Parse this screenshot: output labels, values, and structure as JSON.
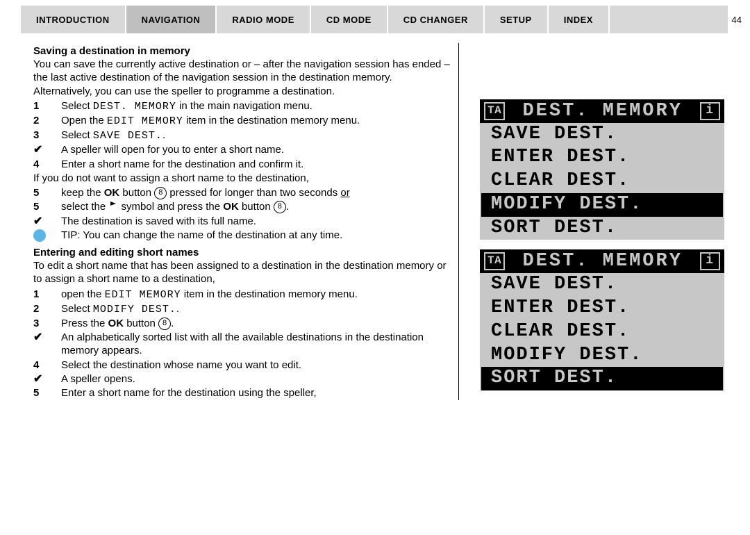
{
  "tabs": [
    "Introduction",
    "Navigation",
    "Radio Mode",
    "Cd Mode",
    "Cd Changer",
    "Setup",
    "Index"
  ],
  "activeTab": 1,
  "pageNumber": "44",
  "section1": {
    "heading": "Saving a destination in memory",
    "intro": "You can save the currently active destination or – after the navigation session has ended – the last active destination of the navigation session in the destination memory. Alternatively, you can use the speller to programme a destination.",
    "s1_pre": "Select ",
    "s1_mono": "DEST. MEMORY",
    "s1_post": " in the main navigation menu.",
    "s2_pre": "Open the ",
    "s2_mono": "EDIT MEMORY",
    "s2_post": " item in the destination memory menu.",
    "s3_pre": "Select ",
    "s3_mono": "SAVE DEST.",
    "s3_post": ".",
    "c1": "A speller will open for you to enter a short name.",
    "s4": "Enter a short name for the destination and confirm it.",
    "para2": "If you do not want to assign a short name to the destination,",
    "s5a_pre": "keep the ",
    "s5a_bold": "OK",
    "s5a_mid": " button ",
    "s5a_btn": "8",
    "s5a_post": " pressed for longer than two seconds ",
    "s5a_or": "or",
    "s5b_pre": "select the ",
    "s5b_mid": " symbol and press the ",
    "s5b_bold": "OK",
    "s5b_mid2": " button ",
    "s5b_btn": "8",
    "s5b_post": ".",
    "c2": "The destination is saved with its full name.",
    "tip": "TIP: You can change the name of the destination at any time."
  },
  "section2": {
    "heading": "Entering and editing short names",
    "intro": "To edit a short name that has been assigned to a destination in the destination memory or to assign a short name to a destination,",
    "s1_pre": "open the ",
    "s1_mono": "EDIT MEMORY",
    "s1_post": " item in the destination memory menu.",
    "s2_pre": "Select ",
    "s2_mono": "MODIFY DEST.",
    "s2_post": ".",
    "s3_pre": "Press the ",
    "s3_bold": "OK",
    "s3_mid": " button ",
    "s3_btn": "8",
    "s3_post": ".",
    "c1": "An alphabetically sorted list with all the available destinations in the destination memory appears.",
    "s4": "Select the destination whose name you want to edit.",
    "c2": "A speller opens.",
    "s5": "Enter a short name for the destination using the speller,"
  },
  "lcd1": {
    "title": "DEST. MEMORY",
    "items": [
      "SAVE DEST.",
      "ENTER DEST.",
      "CLEAR DEST.",
      "MODIFY DEST.",
      "SORT DEST."
    ],
    "highlight": 3
  },
  "lcd2": {
    "title": "DEST. MEMORY",
    "items": [
      "SAVE DEST.",
      "ENTER DEST.",
      "CLEAR DEST.",
      "MODIFY DEST.",
      "SORT DEST."
    ],
    "highlight": 4
  },
  "ta_label": "TA",
  "i_label": "i"
}
